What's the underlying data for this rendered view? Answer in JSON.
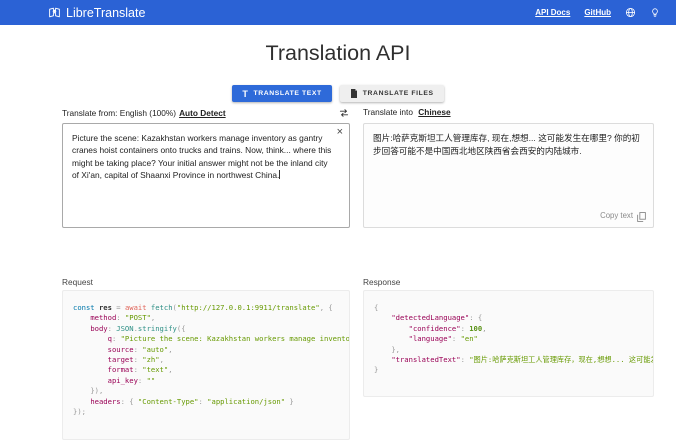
{
  "navbar": {
    "brand": "LibreTranslate",
    "links": {
      "api_docs": "API Docs",
      "github": "GitHub"
    },
    "bg_color": "#2b62d5"
  },
  "page": {
    "title": "Translation API"
  },
  "mode_buttons": {
    "translate_text": "TRANSLATE TEXT",
    "translate_files": "TRANSLATE FILES"
  },
  "source": {
    "label_prefix": "Translate from: English (100%)",
    "auto_detect_label": "Auto Detect",
    "text": "Picture the scene: Kazakhstan workers manage inventory as gantry cranes hoist containers onto trucks and trains. Now, think... where this might be taking place? Your initial answer might not be the inland city of Xi'an, capital of Shaanxi Province in northwest China.",
    "clear_label": "×"
  },
  "target": {
    "label_prefix": "Translate into",
    "language": "Chinese",
    "text": "图片:哈萨克斯坦工人管理库存, 现在,想想... 这可能发生在哪里? 你的初步回答可能不是中国西北地区陕西省会西安的内陆城市.",
    "copy_label": "Copy text"
  },
  "request": {
    "label": "Request",
    "lines": [
      [
        [
          "kw",
          "const"
        ],
        [
          "pl",
          " "
        ],
        [
          "var",
          "res"
        ],
        [
          "pun",
          " = "
        ],
        [
          "kw2",
          "await"
        ],
        [
          "pl",
          " "
        ],
        [
          "fn",
          "fetch"
        ],
        [
          "pun",
          "("
        ],
        [
          "str",
          "\"http://127.0.0.1:9911/translate\""
        ],
        [
          "pun",
          ", {"
        ]
      ],
      [
        [
          "pl",
          "    "
        ],
        [
          "prop",
          "method"
        ],
        [
          "pun",
          ": "
        ],
        [
          "str",
          "\"POST\""
        ],
        [
          "pun",
          ","
        ]
      ],
      [
        [
          "pl",
          "    "
        ],
        [
          "prop",
          "body"
        ],
        [
          "pun",
          ": "
        ],
        [
          "fn",
          "JSON"
        ],
        [
          "pun",
          "."
        ],
        [
          "fn",
          "stringify"
        ],
        [
          "pun",
          "({"
        ]
      ],
      [
        [
          "pl",
          "        "
        ],
        [
          "prop",
          "q"
        ],
        [
          "pun",
          ": "
        ],
        [
          "str",
          "\"Picture the scene: Kazakhstan workers manage inventory as gantry cranes hoist containers onto trucks and trains. Now, think... where this might be taking place? Your initial answer might not be the inland city of Xi'an, capital of Shaanxi Province in northwest China.\""
        ],
        [
          "pun",
          ","
        ]
      ],
      [
        [
          "pl",
          "        "
        ],
        [
          "prop",
          "source"
        ],
        [
          "pun",
          ": "
        ],
        [
          "str",
          "\"auto\""
        ],
        [
          "pun",
          ","
        ]
      ],
      [
        [
          "pl",
          "        "
        ],
        [
          "prop",
          "target"
        ],
        [
          "pun",
          ": "
        ],
        [
          "str",
          "\"zh\""
        ],
        [
          "pun",
          ","
        ]
      ],
      [
        [
          "pl",
          "        "
        ],
        [
          "prop",
          "format"
        ],
        [
          "pun",
          ": "
        ],
        [
          "str",
          "\"text\""
        ],
        [
          "pun",
          ","
        ]
      ],
      [
        [
          "pl",
          "        "
        ],
        [
          "prop",
          "api_key"
        ],
        [
          "pun",
          ": "
        ],
        [
          "str",
          "\"\""
        ]
      ],
      [
        [
          "pl",
          "    "
        ],
        [
          "pun",
          "}),"
        ]
      ],
      [
        [
          "pl",
          "    "
        ],
        [
          "prop",
          "headers"
        ],
        [
          "pun",
          ": { "
        ],
        [
          "str",
          "\"Content-Type\""
        ],
        [
          "pun",
          ": "
        ],
        [
          "str",
          "\"application/json\""
        ],
        [
          "pun",
          " }"
        ]
      ],
      [
        [
          "pun",
          "});"
        ]
      ]
    ]
  },
  "response": {
    "label": "Response",
    "lines": [
      [
        [
          "pun",
          "{"
        ]
      ],
      [
        [
          "pl",
          "    "
        ],
        [
          "prop",
          "\"detectedLanguage\""
        ],
        [
          "pun",
          ": {"
        ]
      ],
      [
        [
          "pl",
          "        "
        ],
        [
          "prop",
          "\"confidence\""
        ],
        [
          "pun",
          ": "
        ],
        [
          "num",
          "100"
        ],
        [
          "pun",
          ","
        ]
      ],
      [
        [
          "pl",
          "        "
        ],
        [
          "prop",
          "\"language\""
        ],
        [
          "pun",
          ": "
        ],
        [
          "str",
          "\"en\""
        ]
      ],
      [
        [
          "pl",
          "    "
        ],
        [
          "pun",
          "},"
        ]
      ],
      [
        [
          "pl",
          "    "
        ],
        [
          "prop",
          "\"translatedText\""
        ],
        [
          "pun",
          ": "
        ],
        [
          "str",
          "\"图片:哈萨克斯坦工人管理库存，现在,想想... 这可能发生在哪里?你的初步回答可能不是中国西北地区陕西省会西安的内陆城市.\""
        ]
      ],
      [
        [
          "pun",
          "}"
        ]
      ]
    ]
  }
}
